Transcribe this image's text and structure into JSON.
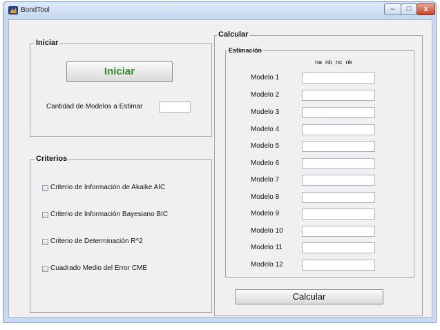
{
  "window": {
    "title": "BondTool",
    "minimize_glyph": "–",
    "maximize_glyph": "□",
    "close_glyph": "x",
    "app_icon": "app-icon"
  },
  "iniciar_panel": {
    "title": "Iniciar",
    "button_label": "Iniciar",
    "button_color": "#2e8b2e",
    "cantidad_label": "Cantidad de Modelos a Estimar",
    "cantidad_value": ""
  },
  "criterios_panel": {
    "title": "Criterios",
    "items": [
      {
        "label": "Criterio de Información de Akaike AIC",
        "checked": false
      },
      {
        "label": "Criterio de Información Bayesiano BIC",
        "checked": false
      },
      {
        "label": "Criterio de Determinación R^2",
        "checked": false
      },
      {
        "label": "Cuadrado Medio del Error CME",
        "checked": false
      }
    ]
  },
  "calcular_panel": {
    "title": "Calcular",
    "estimacion_title": "Estimación",
    "column_header": "na  nb  nc  nk",
    "models": [
      {
        "label": "Modelo 1",
        "value": ""
      },
      {
        "label": "Modelo 2",
        "value": ""
      },
      {
        "label": "Modelo 3",
        "value": ""
      },
      {
        "label": "Modelo 4",
        "value": ""
      },
      {
        "label": "Modelo 5",
        "value": ""
      },
      {
        "label": "Modelo 6",
        "value": ""
      },
      {
        "label": "Modelo 7",
        "value": ""
      },
      {
        "label": "Modelo 8",
        "value": ""
      },
      {
        "label": "Modelo 9",
        "value": ""
      },
      {
        "label": "Modelo 10",
        "value": ""
      },
      {
        "label": "Modelo 11",
        "value": ""
      },
      {
        "label": "Modelo 12",
        "value": ""
      }
    ],
    "button_label": "Calcular"
  }
}
